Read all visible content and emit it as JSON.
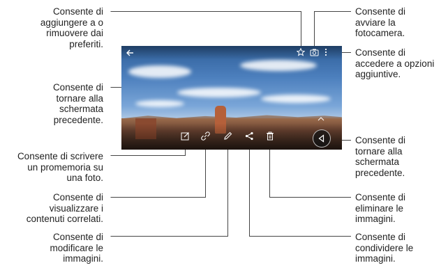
{
  "annotations": {
    "favorite": [
      "Consente di",
      "aggiungere a o",
      "rimuovere dai",
      "preferiti."
    ],
    "back": [
      "Consente di",
      "tornare alla",
      "schermata",
      "precedente."
    ],
    "memo": [
      "Consente di scrivere",
      "un promemoria su",
      "una foto."
    ],
    "related": [
      "Consente di",
      "visualizzare i",
      "contenuti correlati."
    ],
    "edit": [
      "Consente di",
      "modificare le",
      "immagini."
    ],
    "camera": [
      "Consente di",
      "avviare la",
      "fotocamera."
    ],
    "more_options": [
      "Consente di",
      "accedere a opzioni",
      "aggiuntive."
    ],
    "nav_back": [
      "Consente di",
      "tornare alla",
      "schermata",
      "precedente."
    ],
    "delete": [
      "Consente di",
      "eliminare le",
      "immagini."
    ],
    "share": [
      "Consente di",
      "condividere le",
      "immagini."
    ]
  },
  "icons": {
    "back": "back-arrow-icon",
    "favorite": "star-icon",
    "camera": "camera-icon",
    "more_options": "more-vert-icon",
    "memo": "memo-edit-icon",
    "related": "link-icon",
    "edit": "pencil-icon",
    "share": "share-icon",
    "delete": "trash-icon",
    "nav_back": "triangle-back-icon",
    "collapse": "chevron-up-icon"
  },
  "colors": {
    "icon": "#ffffff",
    "leader_line": "#444444",
    "text": "#222222"
  }
}
